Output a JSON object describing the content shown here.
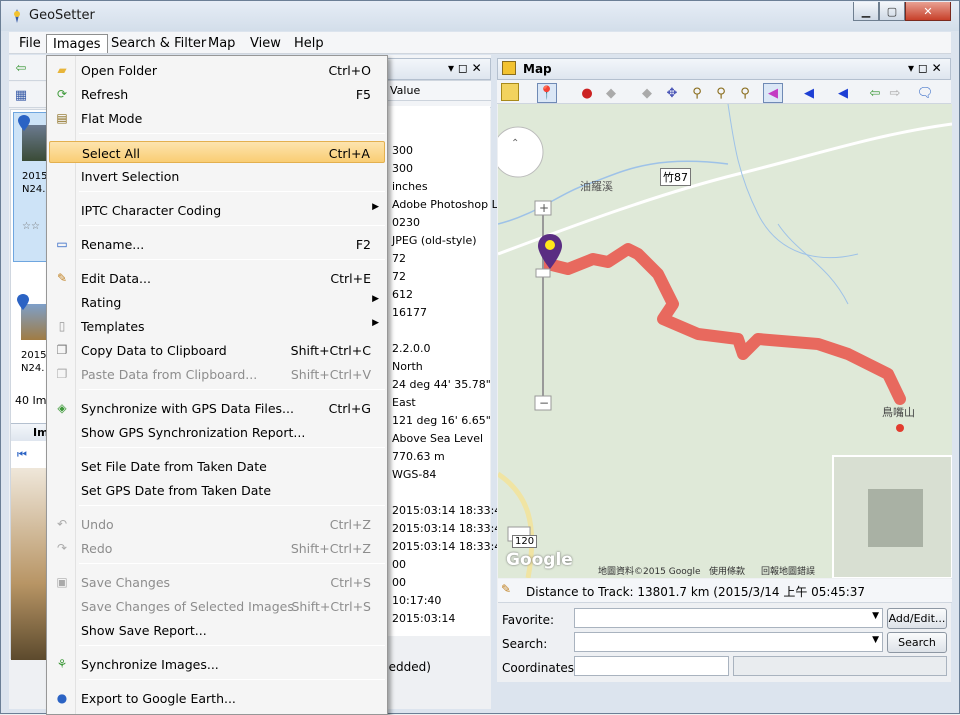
{
  "window": {
    "title": "GeoSetter"
  },
  "menubar": [
    "File",
    "Images",
    "Search & Filter",
    "Map",
    "View",
    "Help"
  ],
  "images_menu": [
    {
      "label": "Open Folder",
      "shortcut": "Ctrl+O",
      "icon": "folder-icon",
      "enabled": true
    },
    {
      "label": "Refresh",
      "shortcut": "F5",
      "icon": "refresh-icon",
      "enabled": true
    },
    {
      "label": "Flat Mode",
      "shortcut": "",
      "icon": "flat-mode-icon",
      "enabled": true
    },
    {
      "label": "Select All",
      "shortcut": "Ctrl+A",
      "enabled": true,
      "highlighted": true
    },
    {
      "label": "Invert Selection",
      "shortcut": "",
      "enabled": true
    },
    {
      "label": "IPTC Character Coding",
      "submenu": true,
      "enabled": true
    },
    {
      "label": "Rename...",
      "shortcut": "F2",
      "icon": "rename-icon",
      "enabled": true
    },
    {
      "label": "Edit Data...",
      "shortcut": "Ctrl+E",
      "icon": "edit-data-icon",
      "enabled": true
    },
    {
      "label": "Rating",
      "submenu": true,
      "enabled": true
    },
    {
      "label": "Templates",
      "submenu": true,
      "icon": "templates-icon",
      "enabled": true
    },
    {
      "label": "Copy Data to Clipboard",
      "shortcut": "Shift+Ctrl+C",
      "icon": "copy-icon",
      "enabled": true
    },
    {
      "label": "Paste Data from Clipboard...",
      "shortcut": "Shift+Ctrl+V",
      "icon": "paste-icon",
      "enabled": false
    },
    {
      "label": "Synchronize with GPS Data Files...",
      "shortcut": "Ctrl+G",
      "icon": "gps-sync-icon",
      "enabled": true
    },
    {
      "label": "Show GPS Synchronization Report...",
      "shortcut": "",
      "enabled": true
    },
    {
      "label": "Set File Date from Taken Date",
      "shortcut": "",
      "enabled": true
    },
    {
      "label": "Set GPS Date from Taken Date",
      "shortcut": "",
      "enabled": true
    },
    {
      "label": "Undo",
      "shortcut": "Ctrl+Z",
      "icon": "undo-icon",
      "enabled": false
    },
    {
      "label": "Redo",
      "shortcut": "Shift+Ctrl+Z",
      "icon": "redo-icon",
      "enabled": false
    },
    {
      "label": "Save Changes",
      "shortcut": "Ctrl+S",
      "icon": "save-icon",
      "enabled": false
    },
    {
      "label": "Save Changes of Selected Images",
      "shortcut": "Shift+Ctrl+S",
      "enabled": false
    },
    {
      "label": "Show Save Report...",
      "shortcut": "",
      "enabled": true
    },
    {
      "label": "Synchronize Images...",
      "shortcut": "",
      "icon": "sync-images-icon",
      "enabled": true
    },
    {
      "label": "Export to Google Earth...",
      "shortcut": "",
      "icon": "google-earth-icon",
      "enabled": true
    }
  ],
  "properties_header": "Value",
  "properties": [
    "300",
    "300",
    "inches",
    "Adobe Photoshop Li",
    "0230",
    "JPEG (old-style)",
    "72",
    "72",
    "612",
    "16177",
    "",
    "2.2.0.0",
    "North",
    "24 deg 44' 35.78\"",
    "East",
    "121 deg 16' 6.65\"",
    "Above Sea Level",
    "770.63 m",
    "WGS-84",
    "",
    "2015:03:14 18:33:4",
    "2015:03:14 18:33:4",
    "2015:03:14 18:33:4",
    "00",
    "00",
    "10:17:40",
    "2015:03:14"
  ],
  "thumbs": [
    {
      "date": "2015",
      "coords": "N24."
    },
    {
      "date": "2015",
      "coords": "N24."
    }
  ],
  "image_count": "40 Im",
  "bottom_panel_label": "Im",
  "embedded_text": "bedded)",
  "map_panel": {
    "title": "Map",
    "labels": {
      "creek": "油羅溪",
      "road": "竹87",
      "road2": "120",
      "peak": "鳥嘴山",
      "google": "Google",
      "copyright": "地圖資料©2015 Google",
      "terms": "使用條款",
      "report": "回報地圖錯誤"
    },
    "distance_text": "Distance to Track: 13801.7 km (2015/3/14 上午 05:45:37",
    "favorite_label": "Favorite:",
    "search_label": "Search:",
    "coordinates_label": "Coordinates:",
    "add_edit_button": "Add/Edit...",
    "search_button": "Search"
  },
  "colors": {
    "track": "#e8695e",
    "highlight": "#f9cd74",
    "map_bg": "#dfe9d8"
  }
}
